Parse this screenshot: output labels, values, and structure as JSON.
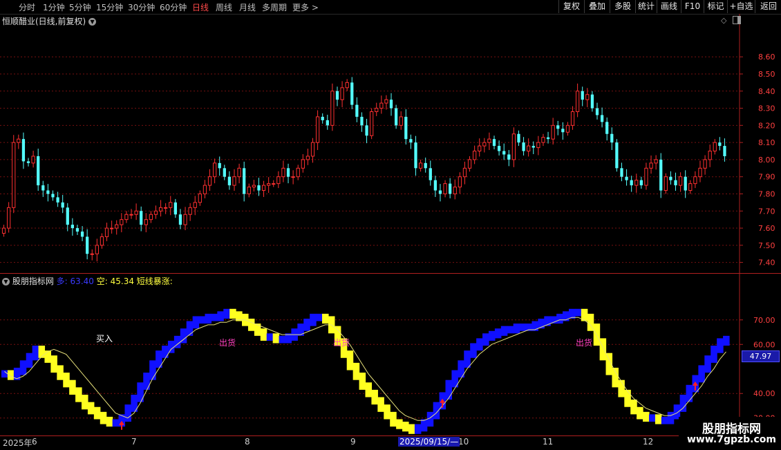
{
  "toolbar": {
    "timeframes": [
      "分时",
      "1分钟",
      "5分钟",
      "15分钟",
      "30分钟",
      "60分钟",
      "日线",
      "周线",
      "月线",
      "多周期",
      "更多 >"
    ],
    "active": "日线",
    "buttons": [
      "复权",
      "叠加",
      "多股",
      "统计",
      "画线",
      "F10",
      "+自选",
      "返回",
      "标记"
    ]
  },
  "main": {
    "title": "恒顺醋业(日线,前复权)",
    "yticks": [
      "8.60",
      "8.50",
      "8.40",
      "8.30",
      "8.20",
      "8.10",
      "8.00",
      "7.90",
      "7.80",
      "7.70",
      "7.60",
      "7.50",
      "7.40"
    ]
  },
  "sub": {
    "name": "股朋指标网",
    "long_label": "多:",
    "long_value": "63.40",
    "short_label": "空:",
    "short_value": "45.34",
    "signal_label": "短线暴涨:",
    "yticks": [
      "70.00",
      "60.00",
      "40.00",
      "30.00"
    ],
    "current_value": "47.97",
    "buy_label": "买入",
    "sell_label": "出货"
  },
  "xaxis": {
    "labels": [
      "2025年",
      "6",
      "7",
      "8",
      "9",
      "10",
      "11",
      "12"
    ],
    "cursor_date": "2025/09/15/—"
  },
  "watermark": {
    "name": "股朋指标网",
    "url": "www.7gpzb.com"
  },
  "colors": {
    "up": "#ff3030",
    "down": "#54ffff",
    "long": "#1010ff",
    "short": "#ffff20",
    "ma": "#e6e07a",
    "sell_text": "#ff40c0",
    "grid": "#7a1010"
  },
  "chart_data": [
    {
      "type": "candlestick",
      "title": "恒顺醋业(日线,前复权)",
      "ylim": [
        7.35,
        8.73
      ],
      "close": [
        7.6,
        7.72,
        8.1,
        8.12,
        7.99,
        7.98,
        8.02,
        7.85,
        7.82,
        7.8,
        7.78,
        7.75,
        7.72,
        7.62,
        7.6,
        7.58,
        7.55,
        7.45,
        7.45,
        7.5,
        7.55,
        7.6,
        7.6,
        7.62,
        7.65,
        7.68,
        7.68,
        7.7,
        7.62,
        7.65,
        7.68,
        7.7,
        7.72,
        7.72,
        7.75,
        7.68,
        7.62,
        7.68,
        7.72,
        7.75,
        7.8,
        7.85,
        7.9,
        7.98,
        7.95,
        7.9,
        7.85,
        7.9,
        7.95,
        7.8,
        7.84,
        7.85,
        7.82,
        7.85,
        7.86,
        7.86,
        7.9,
        7.95,
        7.9,
        7.9,
        7.95,
        8.0,
        8.02,
        8.1,
        8.25,
        8.23,
        8.2,
        8.4,
        8.35,
        8.42,
        8.45,
        8.32,
        8.25,
        8.2,
        8.14,
        8.28,
        8.3,
        8.33,
        8.35,
        8.3,
        8.2,
        8.25,
        8.12,
        8.1,
        7.95,
        7.98,
        7.95,
        7.88,
        7.82,
        7.8,
        7.86,
        7.8,
        7.84,
        7.9,
        7.95,
        8.0,
        8.05,
        8.08,
        8.1,
        8.12,
        8.08,
        8.05,
        8.03,
        8.0,
        8.15,
        8.1,
        8.05,
        8.08,
        8.07,
        8.1,
        8.13,
        8.12,
        8.2,
        8.18,
        8.16,
        8.2,
        8.28,
        8.4,
        8.35,
        8.38,
        8.3,
        8.26,
        8.22,
        8.15,
        8.1,
        7.95,
        7.9,
        7.88,
        7.85,
        7.88,
        7.85,
        7.95,
        7.98,
        8.0,
        7.82,
        7.9,
        7.88,
        7.85,
        7.9,
        7.82,
        7.86,
        7.9,
        7.95,
        8.0,
        8.05,
        8.1,
        8.08,
        8.02
      ],
      "x_labels": [
        "2025年",
        "6",
        "7",
        "8",
        "9",
        "10",
        "11",
        "12"
      ]
    },
    {
      "type": "line",
      "name": "股朋指标网",
      "ylim": [
        24.0,
        86.0
      ],
      "series": [
        {
          "name": "多",
          "values": [
            48,
            47,
            49,
            52,
            55,
            58,
            56,
            54,
            50,
            47,
            44,
            41,
            38,
            35,
            33,
            31,
            29,
            28,
            28,
            30,
            34,
            38,
            43,
            47,
            52,
            56,
            58,
            60,
            62,
            65,
            68,
            70,
            70,
            71,
            71,
            72,
            73,
            72,
            71,
            69,
            67,
            65,
            63,
            63,
            62,
            62,
            63,
            65,
            67,
            69,
            71,
            71,
            70,
            66,
            61,
            56,
            51,
            47,
            43,
            40,
            37,
            34,
            31,
            28,
            27,
            26,
            25,
            26,
            28,
            31,
            35,
            39,
            44,
            48,
            52,
            56,
            59,
            61,
            63,
            64,
            65,
            66,
            66,
            67,
            67,
            67,
            68,
            69,
            70,
            70,
            71,
            72,
            73,
            73,
            71,
            67,
            61,
            55,
            49,
            44,
            40,
            36,
            33,
            31,
            30,
            30,
            29,
            29,
            31,
            34,
            38,
            42,
            46,
            50,
            54,
            58,
            61,
            62
          ]
        },
        {
          "name": "空",
          "values": [
            49,
            47,
            46,
            47,
            49,
            52,
            55,
            57,
            58,
            57,
            56,
            53,
            50,
            47,
            44,
            41,
            38,
            35,
            32,
            31,
            30,
            32,
            36,
            41,
            46,
            50,
            54,
            58,
            60,
            62,
            64,
            66,
            67,
            68,
            68,
            69,
            69,
            70,
            70,
            70,
            69,
            68,
            67,
            66,
            65,
            64,
            64,
            64,
            64,
            65,
            66,
            67,
            68,
            68,
            66,
            63,
            60,
            56,
            52,
            48,
            45,
            42,
            39,
            36,
            33,
            31,
            30,
            29,
            29,
            30,
            32,
            35,
            38,
            42,
            46,
            50,
            53,
            56,
            58,
            60,
            61,
            62,
            63,
            64,
            65,
            66,
            66,
            67,
            68,
            69,
            70,
            70,
            71,
            71,
            70,
            68,
            64,
            59,
            54,
            49,
            45,
            41,
            38,
            36,
            34,
            33,
            32,
            31,
            31,
            32,
            34,
            37,
            40,
            43,
            47,
            50,
            54,
            57
          ]
        }
      ]
    }
  ]
}
